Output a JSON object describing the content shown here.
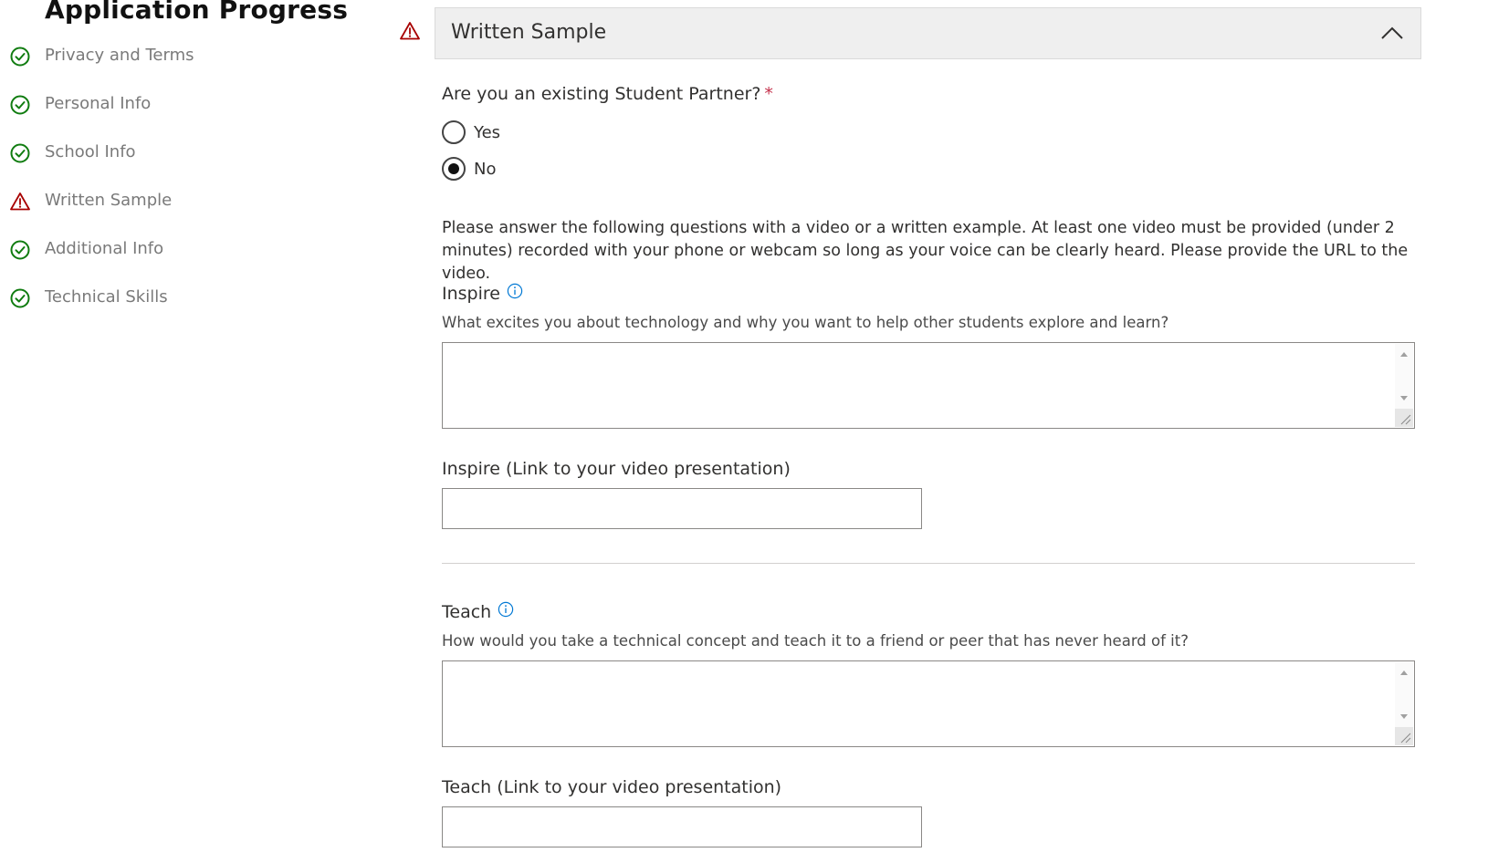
{
  "sidebar": {
    "title": "Application Progress",
    "steps": [
      {
        "label": "Privacy and Terms",
        "status": "complete",
        "icon": "check-circle-icon"
      },
      {
        "label": "Personal Info",
        "status": "complete",
        "icon": "check-circle-icon"
      },
      {
        "label": "School Info",
        "status": "complete",
        "icon": "check-circle-icon"
      },
      {
        "label": "Written Sample",
        "status": "warning",
        "icon": "warning-icon"
      },
      {
        "label": "Additional Info",
        "status": "complete",
        "icon": "check-circle-icon"
      },
      {
        "label": "Technical Skills",
        "status": "complete",
        "icon": "check-circle-icon"
      }
    ]
  },
  "section": {
    "title": "Written Sample",
    "status_icon": "warning-icon",
    "toggle_icon": "chevron-up-icon"
  },
  "question": {
    "label": "Are you an existing Student Partner?",
    "required_marker": "*",
    "options": [
      {
        "label": "Yes",
        "checked": false
      },
      {
        "label": "No",
        "checked": true
      }
    ]
  },
  "instructions": "Please answer the following questions with a video or a written example. At least one video must be provided (under 2 minutes) recorded with your phone or webcam so long as your voice can be clearly heard. Please provide the URL to the video.",
  "fields": {
    "inspire": {
      "label": "Inspire",
      "description": "What excites you about technology and why you want to help other students explore and learn?",
      "value": "",
      "link_label": "Inspire (Link to your video presentation)",
      "link_value": ""
    },
    "teach": {
      "label": "Teach",
      "description": "How would you take a technical concept and teach it to a friend or peer that has never heard of it?",
      "value": "",
      "link_label": "Teach (Link to your video presentation)",
      "link_value": ""
    }
  },
  "colors": {
    "success": "#107c10",
    "warning": "#a80000",
    "info": "#0078d4",
    "required": "#c4314b"
  }
}
